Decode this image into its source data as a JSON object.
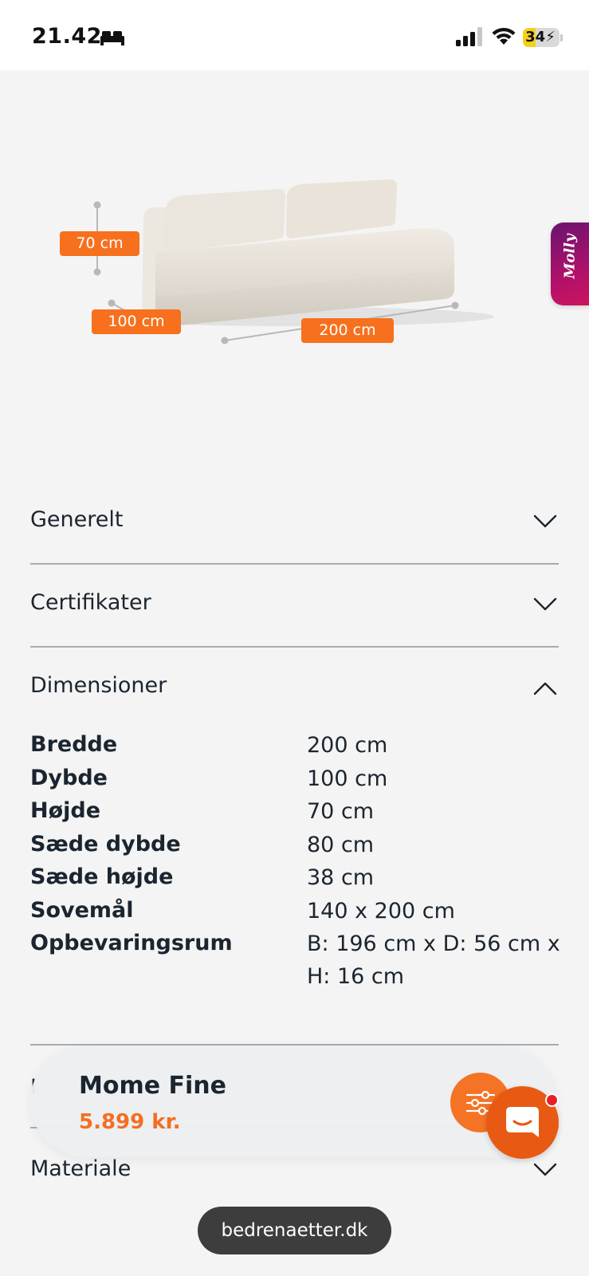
{
  "status_bar": {
    "time": "21.42",
    "battery": "34",
    "battery_level": 0.34
  },
  "product_image": {
    "dimension_tags": {
      "height": "70 cm",
      "depth": "100 cm",
      "width": "200 cm"
    }
  },
  "side_tab": {
    "label": "Molly"
  },
  "accordion": {
    "general": "Generelt",
    "certificates": "Certifikater",
    "dimensions": "Dimensioner",
    "material": "Materiale",
    "hidden_section_initial": "I"
  },
  "specs": [
    {
      "key": "Bredde",
      "value": "200 cm"
    },
    {
      "key": "Dybde",
      "value": "100 cm"
    },
    {
      "key": "Højde",
      "value": "70 cm"
    },
    {
      "key": "Sæde dybde",
      "value": "80 cm"
    },
    {
      "key": "Sæde højde",
      "value": "38 cm"
    },
    {
      "key": "Sovemål",
      "value": "140 x 200 cm"
    },
    {
      "key": "Opbevaringsrum",
      "value": "B: 196 cm x D: 56 cm x H: 16 cm"
    }
  ],
  "sticky_bar": {
    "product_name": "Mome Fine",
    "price": "5.899 kr."
  },
  "browser": {
    "url": "bedrenaetter.dk"
  },
  "colors": {
    "accent_orange": "#f7701e",
    "price_orange": "#f26f22",
    "chat_orange": "#e85a13",
    "text_dark": "#1b2530",
    "molly_purple": "#8a1270"
  }
}
